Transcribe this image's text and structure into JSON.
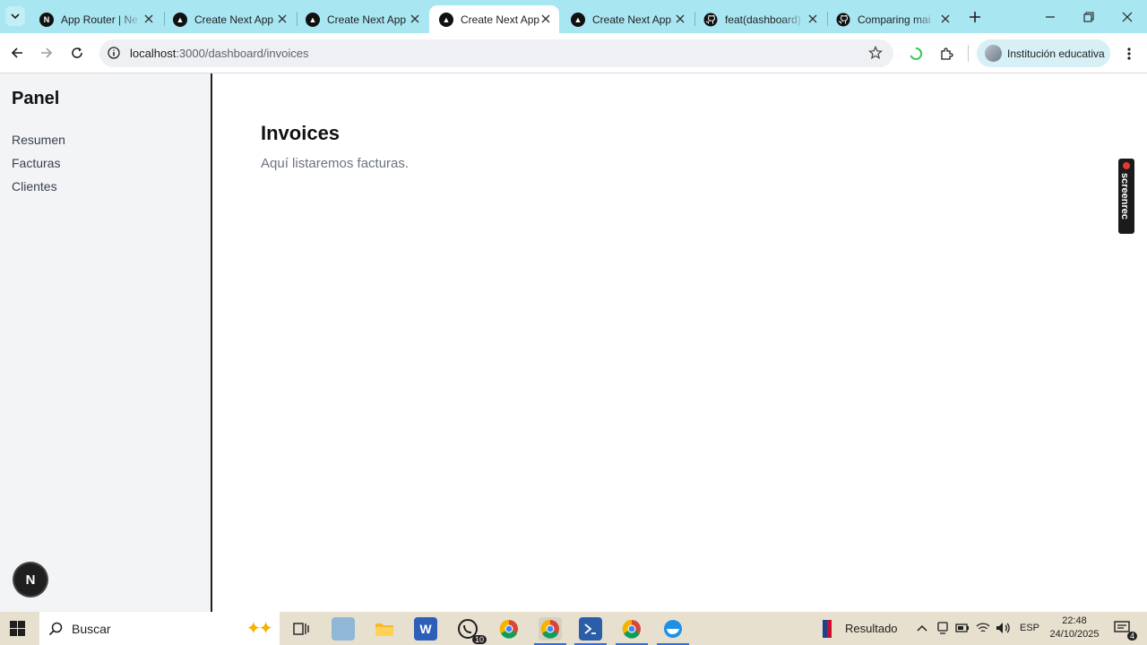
{
  "browser": {
    "tabs": [
      {
        "title": "App Router | Ne",
        "favicon": "nextjs-icon",
        "active": false
      },
      {
        "title": "Create Next App",
        "favicon": "vercel-icon",
        "active": false
      },
      {
        "title": "Create Next App",
        "favicon": "vercel-icon",
        "active": false
      },
      {
        "title": "Create Next App",
        "favicon": "vercel-icon",
        "active": true
      },
      {
        "title": "Create Next App",
        "favicon": "vercel-icon",
        "active": false
      },
      {
        "title": "feat(dashboard)",
        "favicon": "github-icon",
        "active": false
      },
      {
        "title": "Comparing mai",
        "favicon": "github-icon",
        "active": false
      }
    ],
    "url_host": "localhost",
    "url_path": ":3000/dashboard/invoices",
    "profile_label": "Institución educativa"
  },
  "sidebar": {
    "title": "Panel",
    "links": [
      "Resumen",
      "Facturas",
      "Clientes"
    ]
  },
  "main": {
    "heading": "Invoices",
    "subtitle": "Aquí listaremos facturas."
  },
  "dev_indicator": "N",
  "screenrec_label": "screenrec",
  "taskbar": {
    "search_label": "Buscar",
    "whatsapp_badge": "10",
    "tray_label": "Resultado",
    "language": "ESP",
    "time": "22:48",
    "date": "24/10/2025",
    "notifications_badge": "4"
  },
  "colors": {
    "tabstrip": "#a8e6f2",
    "sidebar_bg": "#f3f4f6",
    "taskbar": "#e7e0cf"
  }
}
